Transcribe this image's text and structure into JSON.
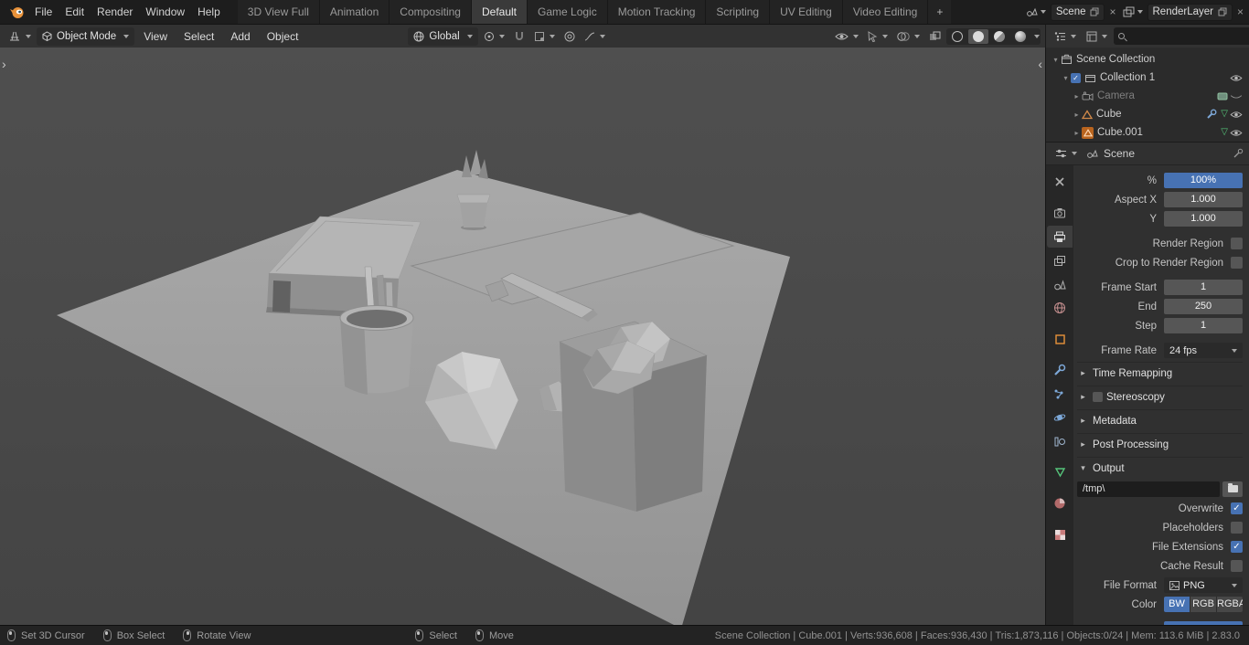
{
  "topbar": {
    "menus": [
      {
        "label": "File"
      },
      {
        "label": "Edit"
      },
      {
        "label": "Render"
      },
      {
        "label": "Window"
      },
      {
        "label": "Help"
      }
    ],
    "tabs": [
      {
        "label": "3D View Full"
      },
      {
        "label": "Animation"
      },
      {
        "label": "Compositing"
      },
      {
        "label": "Default"
      },
      {
        "label": "Game Logic"
      },
      {
        "label": "Motion Tracking"
      },
      {
        "label": "Scripting"
      },
      {
        "label": "UV Editing"
      },
      {
        "label": "Video Editing"
      }
    ],
    "add_tab_label": "+",
    "scene_picker": {
      "value": "Scene"
    },
    "layer_picker": {
      "value": "RenderLayer"
    }
  },
  "viewport_header": {
    "mode": "Object Mode",
    "menus": [
      {
        "label": "View"
      },
      {
        "label": "Select"
      },
      {
        "label": "Add"
      },
      {
        "label": "Object"
      }
    ],
    "orientation": "Global"
  },
  "viewport": {
    "left_collapse": "›",
    "right_collapse": "‹"
  },
  "outliner": {
    "search_placeholder": "",
    "rows": [
      {
        "label": "Scene Collection"
      },
      {
        "label": "Collection 1"
      },
      {
        "label": "Camera"
      },
      {
        "label": "Cube"
      },
      {
        "label": "Cube.001"
      }
    ]
  },
  "properties": {
    "breadcrumb": "Scene",
    "percent_label": "%",
    "percent_value": "100%",
    "aspect_x_label": "Aspect X",
    "aspect_x_value": "1.000",
    "aspect_y_label": "Y",
    "aspect_y_value": "1.000",
    "render_region_label": "Render Region",
    "crop_region_label": "Crop to Render Region",
    "frame_start_label": "Frame Start",
    "frame_start_value": "1",
    "frame_end_label": "End",
    "frame_end_value": "250",
    "frame_step_label": "Step",
    "frame_step_value": "1",
    "frame_rate_label": "Frame Rate",
    "frame_rate_value": "24 fps",
    "time_remapping_label": "Time Remapping",
    "stereoscopy_label": "Stereoscopy",
    "metadata_label": "Metadata",
    "post_processing_label": "Post Processing",
    "output_label": "Output",
    "output_path": "/tmp\\",
    "overwrite_label": "Overwrite",
    "placeholders_label": "Placeholders",
    "file_extensions_label": "File Extensions",
    "cache_result_label": "Cache Result",
    "file_format_label": "File Format",
    "file_format_value": "PNG",
    "color_label": "Color",
    "color_options": {
      "bw": "BW",
      "rgb": "RGB",
      "rgba": "RGBA"
    }
  },
  "status_bar": {
    "hints": [
      {
        "label": "Set 3D Cursor"
      },
      {
        "label": "Box Select"
      },
      {
        "label": "Rotate View"
      },
      {
        "label": "Select"
      },
      {
        "label": "Move"
      }
    ],
    "stats": "Scene Collection | Cube.001 | Verts:936,608 | Faces:936,430 | Tris:1,873,116 | Objects:0/24 | Mem: 113.6 MiB | 2.83.0"
  },
  "colors": {
    "accent": "#4772b3",
    "object_orange": "#e8923a",
    "mesh_green": "#55c47a"
  }
}
